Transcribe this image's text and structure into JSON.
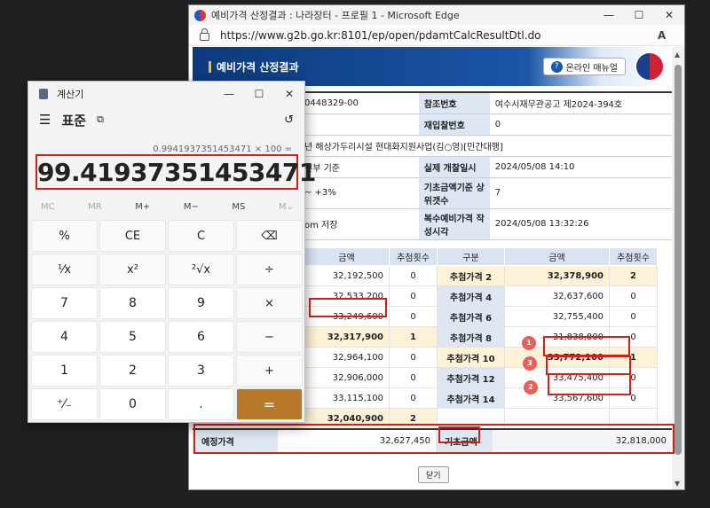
{
  "edge": {
    "title": "예비가격 산정결과 : 나라장터 - 프로필 1 - Microsoft Edge",
    "url": "https://www.g2b.go.kr:8101/ep/open/pdamtCalcResultDtl.do",
    "read_aloud": "A",
    "scroll_up": "▲",
    "scroll_down": "▼"
  },
  "window_controls": {
    "minimize": "—",
    "maximize": "☐",
    "close": "✕"
  },
  "banner": {
    "title": "예비가격 산정결과",
    "manual_icon": "?",
    "manual_label": "온라인 매뉴얼"
  },
  "info": {
    "rows": [
      {
        "left": "0448329-00",
        "label": "참조번호",
        "value": "여수시재무관공고 제2024-394호"
      },
      {
        "left": "",
        "label": "재입찰번호",
        "value": "0"
      },
      {
        "left": "년 해상가두리시설 현대화지원사업(김○영)[민간대행]",
        "label": "",
        "value": ""
      },
      {
        "left": "전부 기준",
        "label": "실제 개찰일시",
        "value": "2024/05/08 14:10"
      },
      {
        "left": "~ +3%",
        "label": "기초금액기준 상위갯수",
        "value": "7"
      },
      {
        "left": "om 저장",
        "label": "복수예비가격 작성시각",
        "value": "2024/05/08 13:32:26"
      }
    ]
  },
  "grid": {
    "headers": {
      "amount_l": "금액",
      "count_l": "추첨횟수",
      "kind": "구분",
      "amount_r": "금액",
      "count_r": "추첨횟수"
    },
    "rows": [
      {
        "amount_l": "32,192,500",
        "count_l": "0",
        "kind": "추첨가격 2",
        "amount_r": "32,378,900",
        "count_r": "2"
      },
      {
        "amount_l": "32,533,200",
        "count_l": "0",
        "kind": "추첨가격 4",
        "amount_r": "32,637,600",
        "count_r": "0"
      },
      {
        "amount_l": "33,249,600",
        "count_l": "0",
        "kind": "추첨가격 6",
        "amount_r": "32,755,400",
        "count_r": "0"
      },
      {
        "amount_l": "32,317,900",
        "count_l": "1",
        "kind": "추첨가격 8",
        "amount_r": "31,838,800",
        "count_r": "0"
      },
      {
        "amount_l": "32,964,100",
        "count_l": "0",
        "kind": "추첨가격 10",
        "amount_r": "33,772,100",
        "count_r": "1"
      },
      {
        "amount_l": "32,906,000",
        "count_l": "0",
        "kind": "추첨가격 12",
        "amount_r": "33,475,400",
        "count_r": "0"
      },
      {
        "amount_l": "33,115,100",
        "count_l": "0",
        "kind": "추첨가격 14",
        "amount_r": "33,567,600",
        "count_r": "0"
      },
      {
        "amount_l": "32,040,900",
        "count_l": "2",
        "kind": "",
        "amount_r": "",
        "count_r": ""
      }
    ]
  },
  "totals": {
    "label1": "예정가격",
    "value1": "32,627,450",
    "label2": "기초금액",
    "value2": "32,818,000"
  },
  "close_label": "닫기",
  "badges": [
    "1",
    "3",
    "2"
  ],
  "calculator": {
    "title": "계산기",
    "mode": "표준",
    "keep_on_top": "⧉",
    "menu": "☰",
    "history_icon": "↺",
    "expression": "0.9941937351453471 × 100 =",
    "display": "99.41937351453471",
    "memory": [
      "MC",
      "MR",
      "M+",
      "M−",
      "MS",
      "M⌄"
    ],
    "keys": [
      "%",
      "CE",
      "C",
      "⌫",
      "¹⁄x",
      "x²",
      "²√x",
      "÷",
      "7",
      "8",
      "9",
      "×",
      "4",
      "5",
      "6",
      "−",
      "1",
      "2",
      "3",
      "+",
      "⁺⁄₋",
      "0",
      ".",
      "="
    ]
  },
  "colors": {
    "accent": "#b67829",
    "highlight_border": "#d0201c",
    "banner": "#0c3a7c"
  }
}
